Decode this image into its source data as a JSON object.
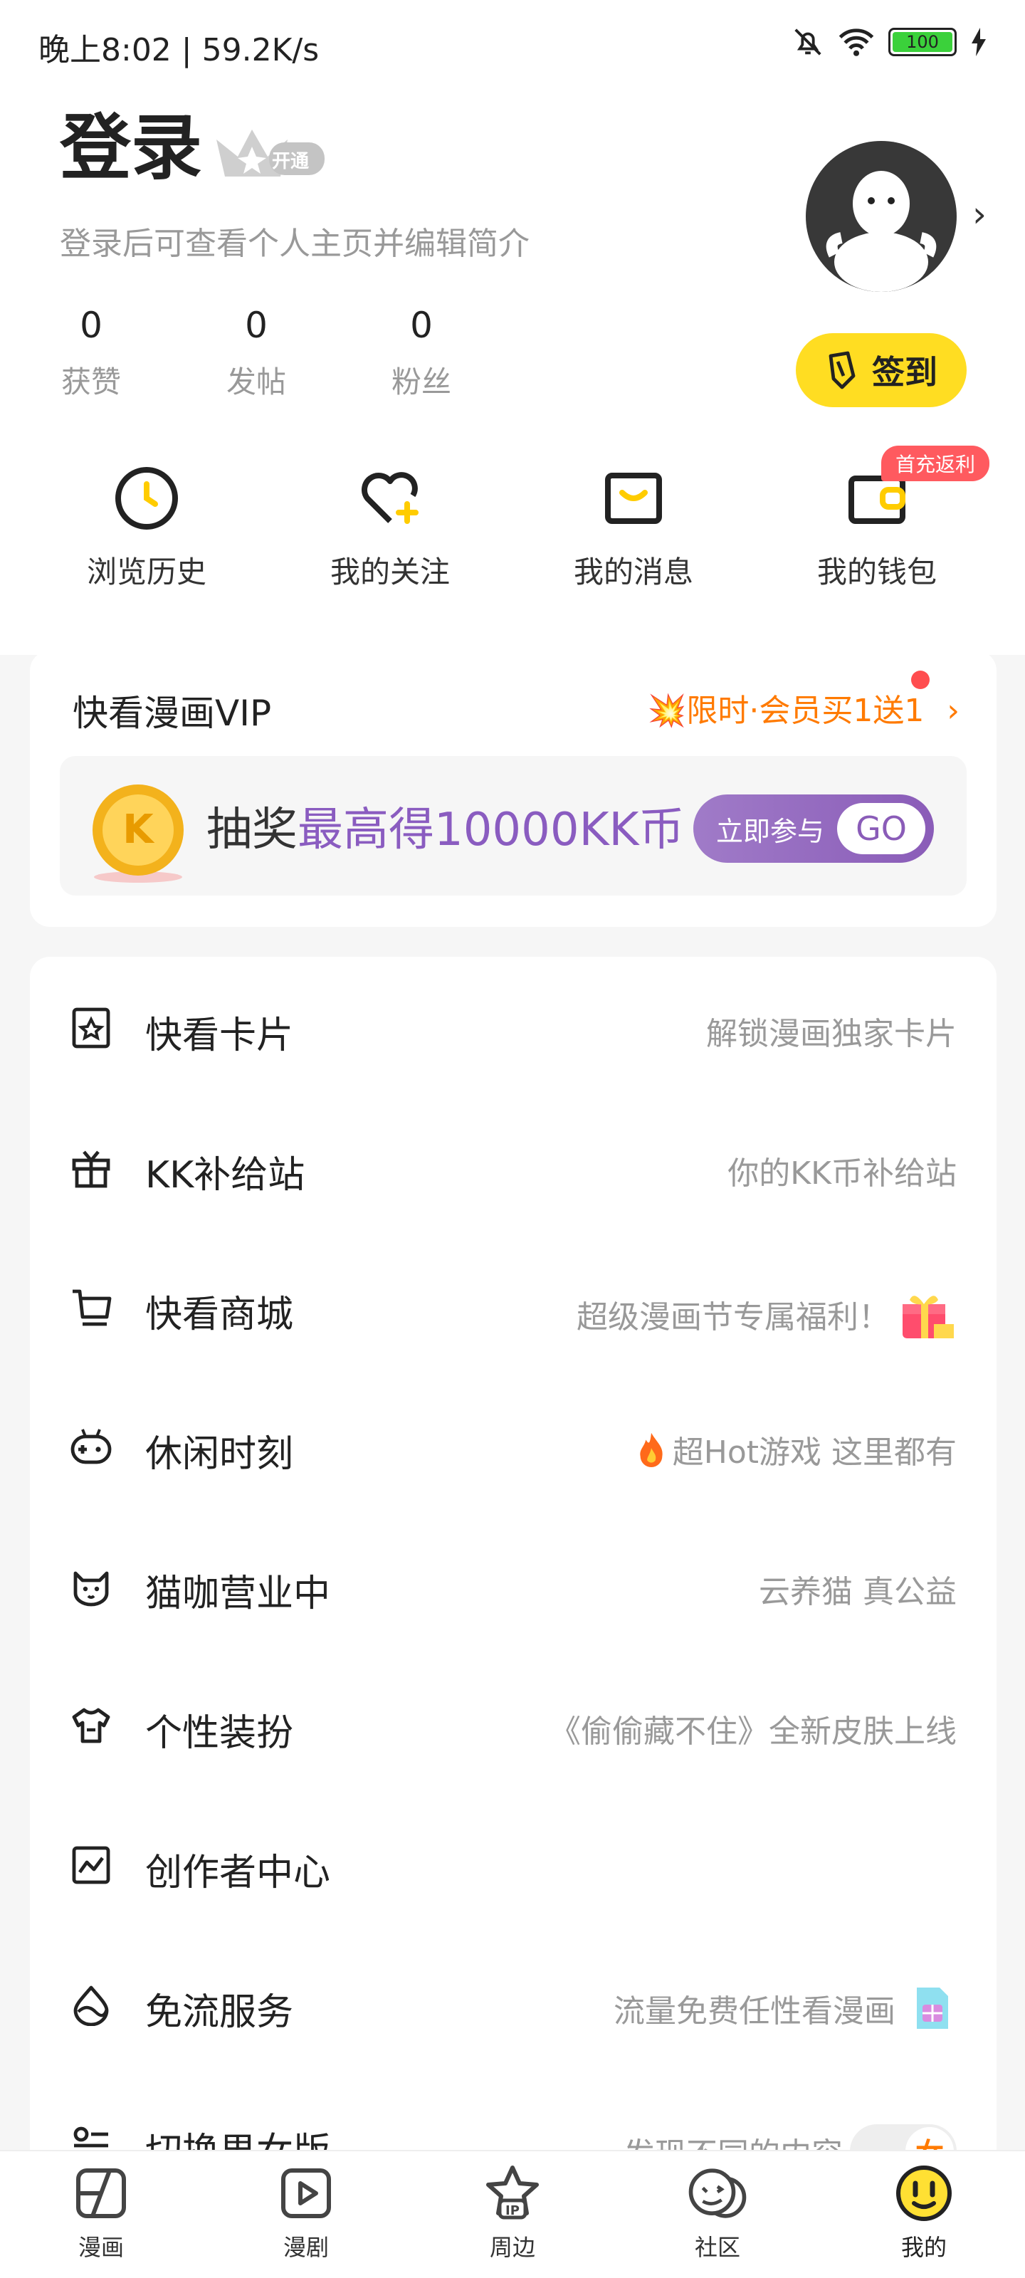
{
  "status_bar": {
    "time": "晚上8:02 | 59.2K/s",
    "battery": "100"
  },
  "profile": {
    "title": "登录",
    "vip_badge": "开通",
    "subtitle": "登录后可查看个人主页并编辑简介",
    "stats": [
      {
        "value": "0",
        "label": "获赞"
      },
      {
        "value": "0",
        "label": "发帖"
      },
      {
        "value": "0",
        "label": "粉丝"
      }
    ],
    "checkin_label": "签到"
  },
  "quick_actions": [
    {
      "label": "浏览历史",
      "icon": "clock-icon"
    },
    {
      "label": "我的关注",
      "icon": "heart-plus-icon"
    },
    {
      "label": "我的消息",
      "icon": "mail-icon"
    },
    {
      "label": "我的钱包",
      "icon": "wallet-icon"
    }
  ],
  "wallet_tag": "首充返利",
  "vip": {
    "title": "快看漫画VIP",
    "promo": "💥限时·会员买1送1",
    "promo_arrow": "›",
    "lottery_a": "抽奖",
    "lottery_b": "最高得10000KK币",
    "join_label": "立即参与",
    "go_label": "GO"
  },
  "menu": [
    {
      "label": "快看卡片",
      "desc": "解锁漫画独家卡片",
      "icon": "card-icon"
    },
    {
      "label": "KK补给站",
      "desc": "你的KK币补给站",
      "icon": "gift-box-icon"
    },
    {
      "label": "快看商城",
      "desc": "超级漫画节专属福利！",
      "icon": "cart-icon"
    },
    {
      "label": "休闲时刻",
      "desc": "超Hot游戏 这里都有",
      "icon": "gamepad-icon"
    },
    {
      "label": "猫咖营业中",
      "desc": "云养猫 真公益",
      "icon": "cat-icon"
    },
    {
      "label": "个性装扮",
      "desc": "《偷偷藏不住》全新皮肤上线",
      "icon": "tshirt-icon"
    },
    {
      "label": "创作者中心",
      "desc": "",
      "icon": "chart-icon"
    },
    {
      "label": "免流服务",
      "desc": "流量免费任性看漫画",
      "icon": "drop-icon"
    },
    {
      "label": "切换男女版",
      "desc": "发现不同的内容",
      "icon": "switch-icon"
    }
  ],
  "tabs": [
    {
      "label": "漫画",
      "icon": "comic-icon"
    },
    {
      "label": "漫剧",
      "icon": "play-icon"
    },
    {
      "label": "周边",
      "icon": "ip-icon"
    },
    {
      "label": "社区",
      "icon": "community-icon"
    },
    {
      "label": "我的",
      "icon": "me-icon"
    }
  ],
  "colors": {
    "accent": "#ffdd22",
    "promo": "#ff7a00",
    "lottery": "#8a5cc0",
    "badge": "#ff5a5f"
  }
}
